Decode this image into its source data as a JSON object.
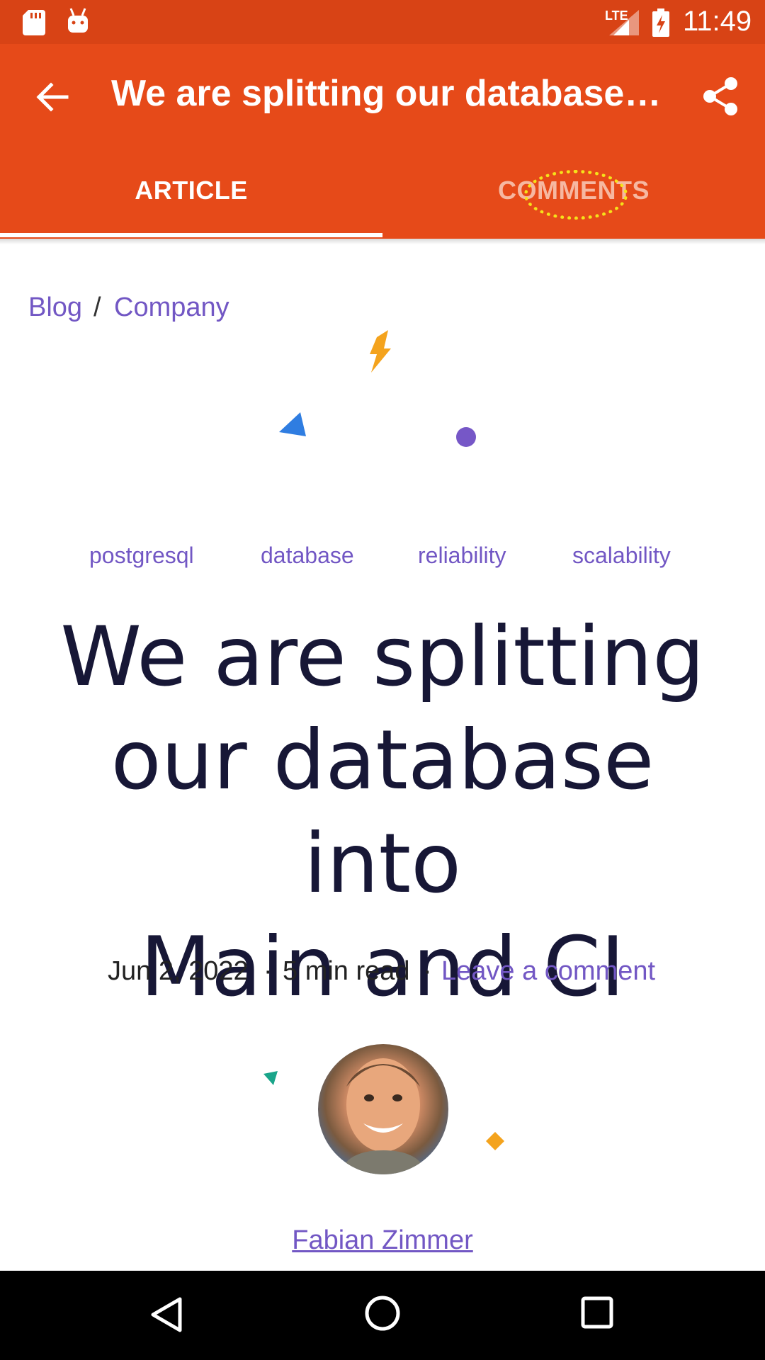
{
  "status_bar": {
    "time": "11:49",
    "network": "LTE",
    "icons": [
      "sd-card-icon",
      "android-debug-icon",
      "signal-icon",
      "battery-charging-icon"
    ]
  },
  "app_bar": {
    "title": "We are splitting our database in…",
    "tabs": [
      {
        "label": "ARTICLE",
        "selected": true
      },
      {
        "label": "COMMENTS",
        "selected": false
      }
    ]
  },
  "breadcrumb": {
    "items": [
      "Blog",
      "Company"
    ],
    "separator": "/"
  },
  "tags": [
    "postgresql",
    "database",
    "reliability",
    "scalability"
  ],
  "article": {
    "headline_lines": [
      "We are splitting",
      "our database into",
      "Main and CI"
    ],
    "date": "Jun 2, 2022",
    "read_time": "5 min read",
    "comment_link": "Leave a comment",
    "dot": "·",
    "author": "Fabian Zimmer"
  },
  "colors": {
    "status_bar": "#d84315",
    "app_bar": "#e64a19",
    "link": "#7257c4",
    "headline": "#171736"
  }
}
